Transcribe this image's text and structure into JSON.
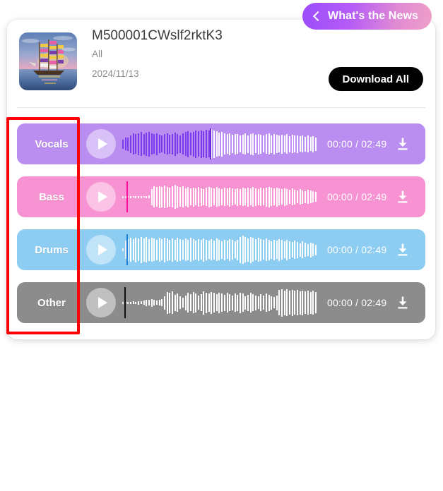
{
  "topbar": {
    "news_button": {
      "label": "What's the News",
      "icon": "chevron-left-icon",
      "gradient_from": "#9b4dfb",
      "gradient_to": "#f0a0c8"
    }
  },
  "card": {
    "thumbnail_alt": "sailing-ship-artwork",
    "title": "M500001CWslf2rktK3",
    "subtitle": "All",
    "date": "2024/11/13",
    "download_all_label": "Download All"
  },
  "tracks": [
    {
      "name": "Vocals",
      "time_current": "00:00",
      "time_total": "02:49",
      "time_display": "00:00 / 02:49",
      "row_color": "#b98ef0",
      "wave_played_color": "#7c3aed",
      "wave_remaining_color": "#ffffff",
      "cursor_color": "#6d28d9",
      "progress_pct": 45,
      "amplitudes": [
        0.3,
        0.42,
        0.46,
        0.6,
        0.72,
        0.66,
        0.74,
        0.8,
        0.7,
        0.78,
        0.84,
        0.72,
        0.66,
        0.74,
        0.62,
        0.58,
        0.66,
        0.72,
        0.64,
        0.7,
        0.78,
        0.66,
        0.6,
        0.72,
        0.8,
        0.88,
        0.76,
        0.84,
        0.92,
        0.86,
        0.94,
        0.88,
        0.96,
        0.9,
        1.0,
        0.94,
        0.86,
        0.78,
        0.84,
        0.72,
        0.66,
        0.74,
        0.62,
        0.7,
        0.66,
        0.58,
        0.64,
        0.72,
        0.6,
        0.68,
        0.74,
        0.62,
        0.7,
        0.64,
        0.58,
        0.66,
        0.72,
        0.6,
        0.68,
        0.62,
        0.56,
        0.64,
        0.58,
        0.66,
        0.54,
        0.62,
        0.56,
        0.6,
        0.52,
        0.58,
        0.5,
        0.56,
        0.48,
        0.54,
        0.46
      ]
    },
    {
      "name": "Bass",
      "time_current": "00:00",
      "time_total": "02:49",
      "time_display": "00:00 / 02:49",
      "row_color": "#f793d2",
      "wave_played_color": "#f0f0f0",
      "wave_remaining_color": "#ffffff",
      "cursor_color": "#ff0fa0",
      "progress_pct": 2,
      "amplitudes": [
        0.08,
        0.06,
        0.05,
        0.06,
        0.05,
        0.06,
        0.07,
        0.06,
        0.05,
        0.08,
        0.1,
        0.55,
        0.72,
        0.66,
        0.74,
        0.68,
        0.76,
        0.7,
        0.64,
        0.72,
        0.8,
        0.74,
        0.66,
        0.72,
        0.6,
        0.68,
        0.56,
        0.64,
        0.58,
        0.66,
        0.6,
        0.54,
        0.62,
        0.7,
        0.64,
        0.58,
        0.66,
        0.6,
        0.54,
        0.62,
        0.56,
        0.64,
        0.58,
        0.52,
        0.6,
        0.54,
        0.62,
        0.56,
        0.64,
        0.58,
        0.66,
        0.6,
        0.54,
        0.62,
        0.56,
        0.64,
        0.7,
        0.62,
        0.56,
        0.64,
        0.58,
        0.52,
        0.6,
        0.54,
        0.48,
        0.56,
        0.5,
        0.44,
        0.52,
        0.46,
        0.4,
        0.48,
        0.42,
        0.38,
        0.34
      ]
    },
    {
      "name": "Drums",
      "time_current": "00:00",
      "time_total": "02:49",
      "time_display": "00:00 / 02:49",
      "row_color": "#8dcdf2",
      "wave_played_color": "#f0f0f0",
      "wave_remaining_color": "#ffffff",
      "cursor_color": "#1f7fd4",
      "progress_pct": 2,
      "amplitudes": [
        0.1,
        0.62,
        0.74,
        0.8,
        0.72,
        0.84,
        0.76,
        0.88,
        0.78,
        0.86,
        0.74,
        0.82,
        0.76,
        0.7,
        0.8,
        0.72,
        0.84,
        0.76,
        0.68,
        0.78,
        0.7,
        0.82,
        0.74,
        0.66,
        0.76,
        0.68,
        0.8,
        0.72,
        0.64,
        0.74,
        0.66,
        0.78,
        0.7,
        0.62,
        0.72,
        0.64,
        0.76,
        0.68,
        0.6,
        0.7,
        0.62,
        0.74,
        0.66,
        0.58,
        0.68,
        0.88,
        0.96,
        0.86,
        0.78,
        0.88,
        0.8,
        0.72,
        0.82,
        0.74,
        0.66,
        0.76,
        0.68,
        0.6,
        0.7,
        0.62,
        0.74,
        0.66,
        0.58,
        0.68,
        0.6,
        0.52,
        0.62,
        0.54,
        0.46,
        0.56,
        0.48,
        0.4,
        0.5,
        0.42,
        0.36
      ]
    },
    {
      "name": "Other",
      "time_current": "00:00",
      "time_total": "02:49",
      "time_display": "00:00 / 02:49",
      "row_color": "#8c8c8c",
      "wave_played_color": "#e8e8e8",
      "wave_remaining_color": "#ffffff",
      "cursor_color": "#111111",
      "progress_pct": 1,
      "amplitudes": [
        0.06,
        0.05,
        0.08,
        0.06,
        0.1,
        0.07,
        0.12,
        0.09,
        0.14,
        0.22,
        0.18,
        0.26,
        0.2,
        0.14,
        0.18,
        0.24,
        0.46,
        0.74,
        0.68,
        0.76,
        0.54,
        0.62,
        0.42,
        0.34,
        0.5,
        0.66,
        0.58,
        0.72,
        0.64,
        0.48,
        0.56,
        0.78,
        0.7,
        0.62,
        0.74,
        0.66,
        0.58,
        0.7,
        0.62,
        0.54,
        0.66,
        0.58,
        0.5,
        0.62,
        0.54,
        0.7,
        0.62,
        0.46,
        0.54,
        0.66,
        0.58,
        0.5,
        0.42,
        0.56,
        0.48,
        0.62,
        0.54,
        0.46,
        0.38,
        0.5,
        0.86,
        0.92,
        0.84,
        0.9,
        0.82,
        0.88,
        0.8,
        0.86,
        0.78,
        0.84,
        0.76,
        0.82,
        0.74,
        0.8,
        0.72
      ]
    }
  ],
  "annotation": {
    "type": "highlight-rectangle",
    "color": "#ff0000"
  },
  "icons": {
    "download": "download-icon",
    "play": "play-icon",
    "back": "chevron-left-icon"
  }
}
